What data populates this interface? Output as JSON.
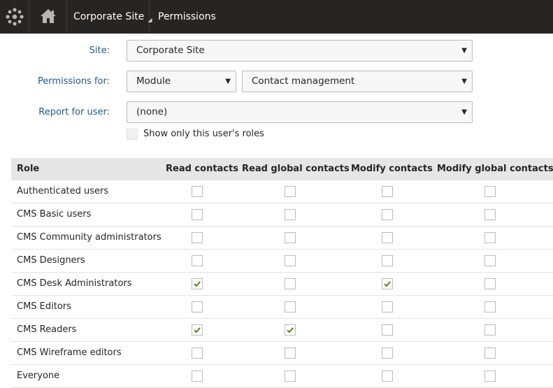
{
  "header": {
    "site_name": "Corporate Site",
    "site_caret": "◢",
    "app_title": "Permissions"
  },
  "form": {
    "site_label": "Site:",
    "site_value": "Corporate Site",
    "permissions_for_label": "Permissions for:",
    "permissions_type_value": "Module",
    "permissions_module_value": "Contact management",
    "report_for_user_label": "Report for user:",
    "report_for_user_value": "(none)",
    "show_only_label": "Show only this user's roles",
    "show_only_checked": false
  },
  "table": {
    "columns": [
      "Role",
      "Read contacts",
      "Read global contacts",
      "Modify contacts",
      "Modify global contacts"
    ],
    "rows": [
      {
        "role": "Authenticated users",
        "perms": [
          false,
          false,
          false,
          false
        ]
      },
      {
        "role": "CMS Basic users",
        "perms": [
          false,
          false,
          false,
          false
        ]
      },
      {
        "role": "CMS Community administrators",
        "perms": [
          false,
          false,
          false,
          false
        ]
      },
      {
        "role": "CMS Designers",
        "perms": [
          false,
          false,
          false,
          false
        ]
      },
      {
        "role": "CMS Desk Administrators",
        "perms": [
          true,
          false,
          true,
          false
        ]
      },
      {
        "role": "CMS Editors",
        "perms": [
          false,
          false,
          false,
          false
        ]
      },
      {
        "role": "CMS Readers",
        "perms": [
          true,
          true,
          false,
          false
        ]
      },
      {
        "role": "CMS Wireframe editors",
        "perms": [
          false,
          false,
          false,
          false
        ]
      },
      {
        "role": "Everyone",
        "perms": [
          false,
          false,
          false,
          false
        ]
      }
    ]
  },
  "colors": {
    "topbar": "#262524",
    "label_blue": "#1f5a93",
    "check_green": "#497d04",
    "header_row": "#e6e6e6"
  },
  "icons": {
    "logo": "kentico-logo-icon",
    "home": "home-icon",
    "dropdown": "dropdown-arrow-icon",
    "check": "checkmark-icon"
  }
}
